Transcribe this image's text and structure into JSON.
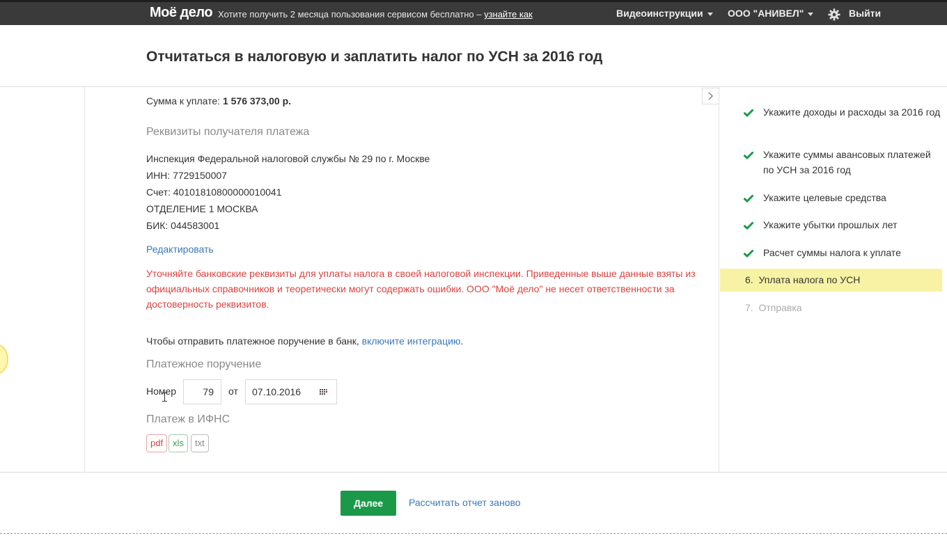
{
  "topbar": {
    "logo": "Моё дело",
    "promo_text": "Хотите получить 2 месяца пользования сервисом бесплатно – ",
    "promo_link": "узнайте как",
    "video": "Видеоинструкции",
    "company": "ООО \"АНИВЕЛ\"",
    "logout": "Выйти"
  },
  "page": {
    "title": "Отчитаться в налоговую и заплатить налог по УСН за 2016 год"
  },
  "payment": {
    "sum_label": "Сумма к уплате: ",
    "sum_value": "1 576 373,00 р.",
    "recipient_title": "Реквизиты получателя платежа",
    "lines": [
      "Инспекция Федеральной налоговой службы № 29 по г. Москве",
      "ИНН: 7729150007",
      "Счет: 40101810800000010041",
      "ОТДЕЛЕНИЕ 1 МОСКВА",
      "БИК: 044583001"
    ],
    "edit_link": "Редактировать",
    "warning": "Уточняйте банковские реквизиты для уплаты налога в своей налоговой инспекции. Приведенные выше данные взяты из официальных справочников и теоретически могут содержать ошибки. ООО \"Моё дело\" не несет ответственности за достоверность реквизитов.",
    "bank_text": "Чтобы отправить платежное поручение в банк, ",
    "bank_link": "включите интеграцию",
    "bank_dot": ".",
    "order_title": "Платежное поручение",
    "number_label": "Номер",
    "number_value": "79",
    "from_label": "от",
    "date_value": "07.10.2016",
    "ifns_title": "Платеж в ИФНС",
    "formats": [
      "pdf",
      "xls",
      "txt"
    ]
  },
  "steps": [
    {
      "label": "Укажите доходы и расходы за 2016 год",
      "done": true
    },
    {
      "label": "Укажите суммы авансовых платежей по УСН за 2016 год",
      "done": true
    },
    {
      "label": "Укажите целевые средства",
      "done": true
    },
    {
      "label": "Укажите убытки прошлых лет",
      "done": true
    },
    {
      "label": "Расчет суммы налога к уплате",
      "done": true
    },
    {
      "label": "Уплата налога по УСН",
      "num": "6.",
      "active": true
    },
    {
      "label": "Отправка",
      "num": "7.",
      "disabled": true
    }
  ],
  "footer": {
    "next": "Далее",
    "recalc": "Рассчитать отчет заново"
  },
  "colors": {
    "topbar": "#3a3a3a",
    "link": "#3a78b8",
    "warning": "#d9433f",
    "accent_green": "#1a9a48",
    "active_step": "#f8f3a4"
  }
}
